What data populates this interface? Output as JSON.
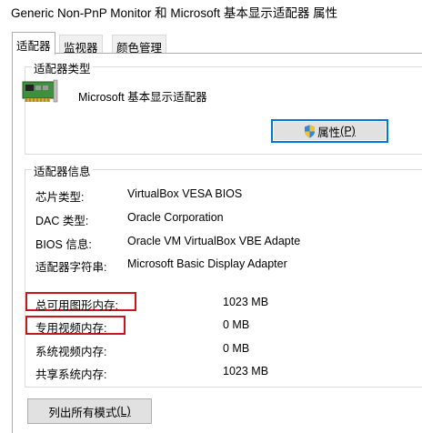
{
  "window": {
    "title": "Generic Non-PnP Monitor 和 Microsoft 基本显示适配器 属性"
  },
  "tabs": [
    {
      "label": "适配器",
      "active": true
    },
    {
      "label": "监视器",
      "active": false
    },
    {
      "label": "颜色管理",
      "active": false
    }
  ],
  "adapter_type": {
    "group_title": "适配器类型",
    "name": "Microsoft 基本显示适配器",
    "properties_button": {
      "label": "属性",
      "mnemonic": "(P)",
      "icon": "uac-shield-icon"
    }
  },
  "adapter_info": {
    "group_title": "适配器信息",
    "rows": [
      {
        "label": "芯片类型:",
        "value": "VirtualBox VESA BIOS"
      },
      {
        "label": "DAC 类型:",
        "value": "Oracle Corporation"
      },
      {
        "label": "BIOS 信息:",
        "value": "Oracle VM VirtualBox VBE Adapte"
      },
      {
        "label": "适配器字符串:",
        "value": "Microsoft Basic Display Adapter"
      }
    ],
    "memory": [
      {
        "label": "总可用图形内存:",
        "value": "1023 MB",
        "highlighted": true
      },
      {
        "label": "专用视频内存:",
        "value": "0 MB",
        "highlighted": true
      },
      {
        "label": "系统视频内存:",
        "value": "0 MB",
        "highlighted": false
      },
      {
        "label": "共享系统内存:",
        "value": "1023 MB",
        "highlighted": false
      }
    ]
  },
  "list_modes_button": {
    "label": "列出所有模式",
    "mnemonic": "(L)"
  },
  "colors": {
    "accent": "#0078d7",
    "highlight": "#c8161d"
  }
}
